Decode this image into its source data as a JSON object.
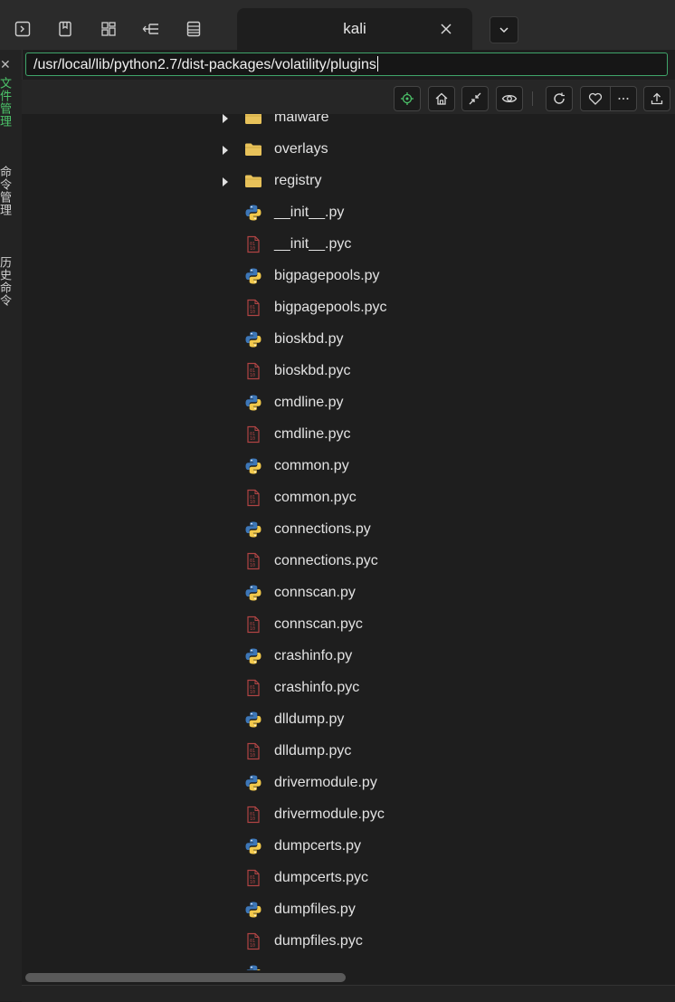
{
  "titlebar": {
    "buttons": [
      {
        "name": "terminal-icon"
      },
      {
        "name": "bookmark-icon"
      },
      {
        "name": "layout-grid-icon"
      },
      {
        "name": "tree-icon"
      },
      {
        "name": "list-panel-icon"
      }
    ]
  },
  "tab": {
    "title": "kali"
  },
  "sidebar": {
    "close_glyph": "✕",
    "tabs": [
      {
        "label": "文件管理",
        "active": true
      },
      {
        "label": "命令管理",
        "active": false
      },
      {
        "label": "历史命令",
        "active": false
      }
    ]
  },
  "address": {
    "path": "/usr/local/lib/python2.7/dist-packages/volatility/plugins"
  },
  "toolbar": {
    "buttons": [
      "locate-icon",
      "home-icon",
      "collapse-icon",
      "eye-icon",
      "refresh-icon",
      "heart-icon",
      "more-icon",
      "upload-icon"
    ]
  },
  "files": [
    {
      "name": "malware",
      "type": "folder"
    },
    {
      "name": "overlays",
      "type": "folder"
    },
    {
      "name": "registry",
      "type": "folder"
    },
    {
      "name": "__init__.py",
      "type": "py"
    },
    {
      "name": "__init__.pyc",
      "type": "pyc"
    },
    {
      "name": "bigpagepools.py",
      "type": "py"
    },
    {
      "name": "bigpagepools.pyc",
      "type": "pyc"
    },
    {
      "name": "bioskbd.py",
      "type": "py"
    },
    {
      "name": "bioskbd.pyc",
      "type": "pyc"
    },
    {
      "name": "cmdline.py",
      "type": "py"
    },
    {
      "name": "cmdline.pyc",
      "type": "pyc"
    },
    {
      "name": "common.py",
      "type": "py"
    },
    {
      "name": "common.pyc",
      "type": "pyc"
    },
    {
      "name": "connections.py",
      "type": "py"
    },
    {
      "name": "connections.pyc",
      "type": "pyc"
    },
    {
      "name": "connscan.py",
      "type": "py"
    },
    {
      "name": "connscan.pyc",
      "type": "pyc"
    },
    {
      "name": "crashinfo.py",
      "type": "py"
    },
    {
      "name": "crashinfo.pyc",
      "type": "pyc"
    },
    {
      "name": "dlldump.py",
      "type": "py"
    },
    {
      "name": "dlldump.pyc",
      "type": "pyc"
    },
    {
      "name": "drivermodule.py",
      "type": "py"
    },
    {
      "name": "drivermodule.pyc",
      "type": "pyc"
    },
    {
      "name": "dumpcerts.py",
      "type": "py"
    },
    {
      "name": "dumpcerts.pyc",
      "type": "pyc"
    },
    {
      "name": "dumpfiles.py",
      "type": "py"
    },
    {
      "name": "dumpfiles.pyc",
      "type": "pyc"
    },
    {
      "name": "",
      "type": "py"
    }
  ],
  "colors": {
    "accent": "#4cc46a",
    "folder": "#e8c25a",
    "pyc": "#b04444",
    "python_blue": "#3d77b8",
    "python_yellow": "#f2c94c"
  }
}
